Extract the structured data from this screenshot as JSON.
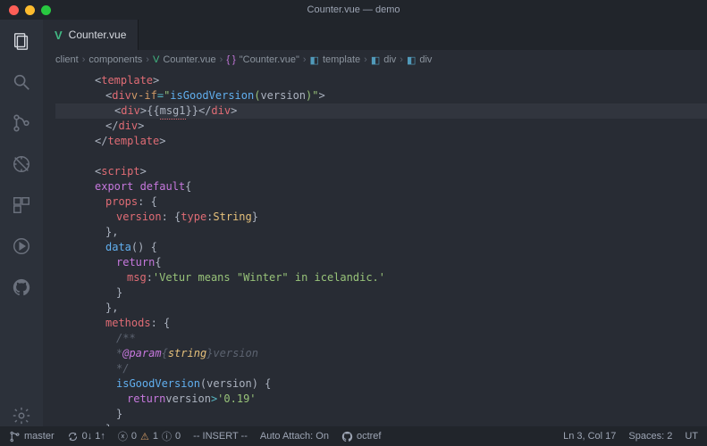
{
  "title": "Counter.vue — demo",
  "tab": {
    "label": "Counter.vue"
  },
  "breadcrumb": [
    "client",
    "components",
    "Counter.vue",
    "\"Counter.vue\"",
    "template",
    "div",
    "div"
  ],
  "cursor": {
    "line": 3,
    "col": 17
  },
  "status": {
    "branch": "master",
    "sync": "0↓ 1↑",
    "errors": 0,
    "warnings": 1,
    "info": 0,
    "mode": "-- INSERT --",
    "autoAttach": "Auto Attach: On",
    "remote": "octref",
    "lncol": "Ln 3, Col 17",
    "spaces": "Spaces: 2",
    "enc": "UT"
  },
  "code": {
    "l1": [
      "<",
      "template",
      ">"
    ],
    "l2": [
      "<",
      "div",
      " v-if",
      "=",
      "\"",
      "isGoodVersion",
      "(",
      "version",
      ")",
      "\"",
      ">"
    ],
    "l3": [
      "<",
      "div",
      ">",
      "{{ ",
      "msg1",
      " }}",
      "</",
      "div",
      ">"
    ],
    "l4": [
      "</",
      "div",
      ">"
    ],
    "l5": [
      "</",
      "template",
      ">"
    ],
    "l7": [
      "<",
      "script",
      ">"
    ],
    "l8": [
      "export default",
      " {"
    ],
    "l9": [
      "props",
      ": {"
    ],
    "l10": [
      "version",
      ": { ",
      "type",
      ": ",
      "String",
      " }"
    ],
    "l11": [
      "},"
    ],
    "l12": [
      "data",
      " () {"
    ],
    "l13": [
      "return",
      " {"
    ],
    "l14": [
      "msg",
      ": ",
      "'Vetur means \"Winter\" in icelandic.'"
    ],
    "l15": [
      "}"
    ],
    "l16": [
      "},"
    ],
    "l17": [
      "methods",
      ": {"
    ],
    "l18": [
      "/**"
    ],
    "l19": [
      " * ",
      "@param",
      " {",
      "string",
      "} ",
      "version"
    ],
    "l20": [
      " */"
    ],
    "l21": [
      "isGoodVersion",
      "(",
      "version",
      ") {"
    ],
    "l22": [
      "return",
      " version ",
      ">",
      " ",
      "'0.19'"
    ],
    "l23": [
      "}"
    ],
    "l24": [
      "}"
    ]
  }
}
